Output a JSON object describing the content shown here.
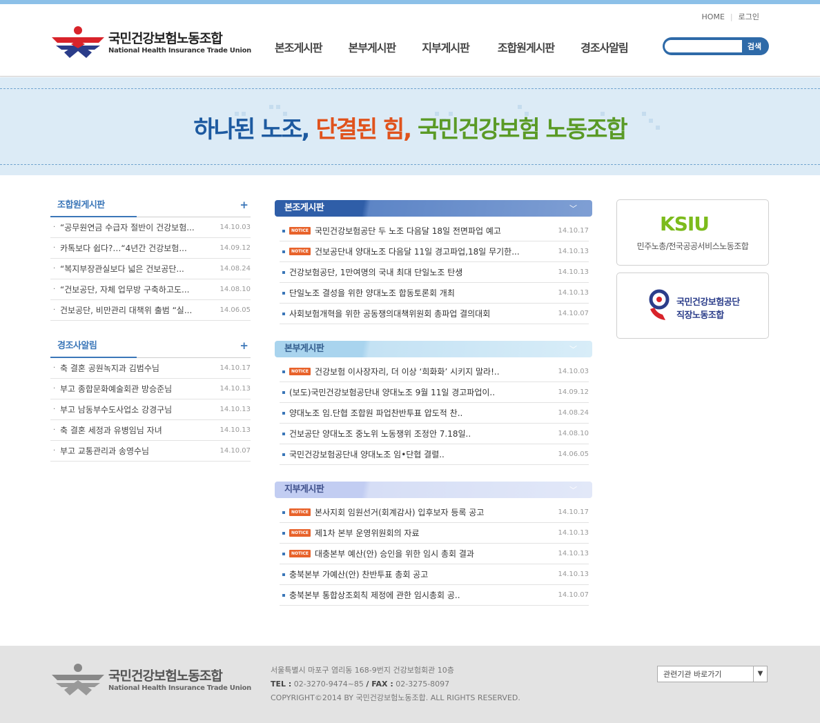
{
  "util": {
    "home": "HOME",
    "login": "로그인"
  },
  "logo": {
    "title": "국민건강보험노동조합",
    "subtitle": "National Health Insurance Trade Union"
  },
  "nav": [
    "본조게시판",
    "본부게시판",
    "지부게시판",
    "조합원게시판",
    "경조사알림"
  ],
  "search": {
    "value": "",
    "button": "검색"
  },
  "banner": {
    "part1": "하나된 노조,",
    "part2": "단결된 힘,",
    "part3": "국민건강보험 노동조합"
  },
  "left": {
    "member": {
      "title": "조합원게시판",
      "more": "+",
      "items": [
        {
          "text": "“공무원연금 수급자 절반이 건강보험...",
          "date": "14.10.03"
        },
        {
          "text": "카톡보다 쉽다?…“4년간 건강보험...",
          "date": "14.09.12"
        },
        {
          "text": "“복지부장관실보다 넓은 건보공단...",
          "date": "14.08.24"
        },
        {
          "text": "“건보공단, 자체 업무방 구축하고도...",
          "date": "14.08.10"
        },
        {
          "text": "건보공단, 비만관리 대책위 출범 “실...",
          "date": "14.06.05"
        }
      ]
    },
    "events": {
      "title": "경조사알림",
      "more": "+",
      "items": [
        {
          "text": "축 결혼 공원녹지과 김범수님",
          "date": "14.10.17"
        },
        {
          "text": "부고 종합문화예술회관 방승준님",
          "date": "14.10.13"
        },
        {
          "text": "부고 남동부수도사업소 강경구님",
          "date": "14.10.13"
        },
        {
          "text": "축 결혼 세정과 유병임님 자녀",
          "date": "14.10.13"
        },
        {
          "text": "부고 교통관리과 송영수님",
          "date": "14.10.07"
        }
      ]
    }
  },
  "boards": [
    {
      "title": "본조게시판",
      "chevron": "﹀",
      "items": [
        {
          "notice": true,
          "text": "국민건강보험공단 두 노조 다음달 18일 전면파업 예고",
          "date": "14.10.17"
        },
        {
          "notice": true,
          "text": "건보공단내 양대노조 다음달 11일 경고파업,18일 무기한...",
          "date": "14.10.13"
        },
        {
          "notice": false,
          "text": "건강보험공단, 1만여명의 국내 최대 단일노조 탄생",
          "date": "14.10.13"
        },
        {
          "notice": false,
          "text": "단일노조 결성을 위한 양대노조 합동토론회 개최",
          "date": "14.10.13"
        },
        {
          "notice": false,
          "text": "사회보험개혁을 위한 공동쟁의대책위원회 총파업 결의대회",
          "date": "14.10.07"
        }
      ]
    },
    {
      "title": "본부게시판",
      "chevron": "﹀",
      "items": [
        {
          "notice": true,
          "text": "건강보험 이사장자리, 더 이상 ‘희화화’ 시키지 말라!..",
          "date": "14.10.03"
        },
        {
          "notice": false,
          "text": "(보도)국민건강보험공단내 양대노조 9월 11일 경고파업이..",
          "date": "14.09.12"
        },
        {
          "notice": false,
          "text": "양대노조 임.단협 조합원 파업찬반투표 압도적 찬..",
          "date": "14.08.24"
        },
        {
          "notice": false,
          "text": "건보공단 양대노조 중노위 노동쟁위 조정안 7.18일..",
          "date": "14.08.10"
        },
        {
          "notice": false,
          "text": "국민건강보험공단내 양대노조 임•단협 결렬..",
          "date": "14.06.05"
        }
      ]
    },
    {
      "title": "지부게시판",
      "chevron": "﹀",
      "items": [
        {
          "notice": true,
          "text": "본사지회 임원선거(회계감사) 입후보자 등록 공고",
          "date": "14.10.17"
        },
        {
          "notice": true,
          "text": " 제1차 본부 운영위원회의 자료",
          "date": "14.10.13"
        },
        {
          "notice": true,
          "text": " 대충본부 예산(안) 승인을 위한 임시 총회 결과",
          "date": "14.10.13"
        },
        {
          "notice": false,
          "text": "충북본부 가예산(안) 찬반투표 총회 공고",
          "date": "14.10.13"
        },
        {
          "notice": false,
          "text": "충북본부 통합상조회칙 제정에 관한 임시총회 공..",
          "date": "14.10.07"
        }
      ]
    }
  ],
  "notice_badge": "NOTICE",
  "right": {
    "ksiu": {
      "logo": "KSIU",
      "caption": "민주노총/전국공공서비스노동조합"
    },
    "union": {
      "line1": "국민건강보험공단",
      "line2": "직장노동조합"
    }
  },
  "footer": {
    "title": "국민건강보험노동조합",
    "subtitle": "National Health Insurance Trade Union",
    "address": "서울특별시 마포구 염리동 168-9번지 건강보험회관 10층",
    "tel_label": "TEL :",
    "tel": "02-3270-9474~85",
    "fax_label": "/ FAX :",
    "fax": "02-3275-8097",
    "copyright": "COPYRIGHT©2014 BY 국민건강보험노동조합. ALL RIGHTS RESERVED.",
    "select": "관련기관 바로가기"
  }
}
